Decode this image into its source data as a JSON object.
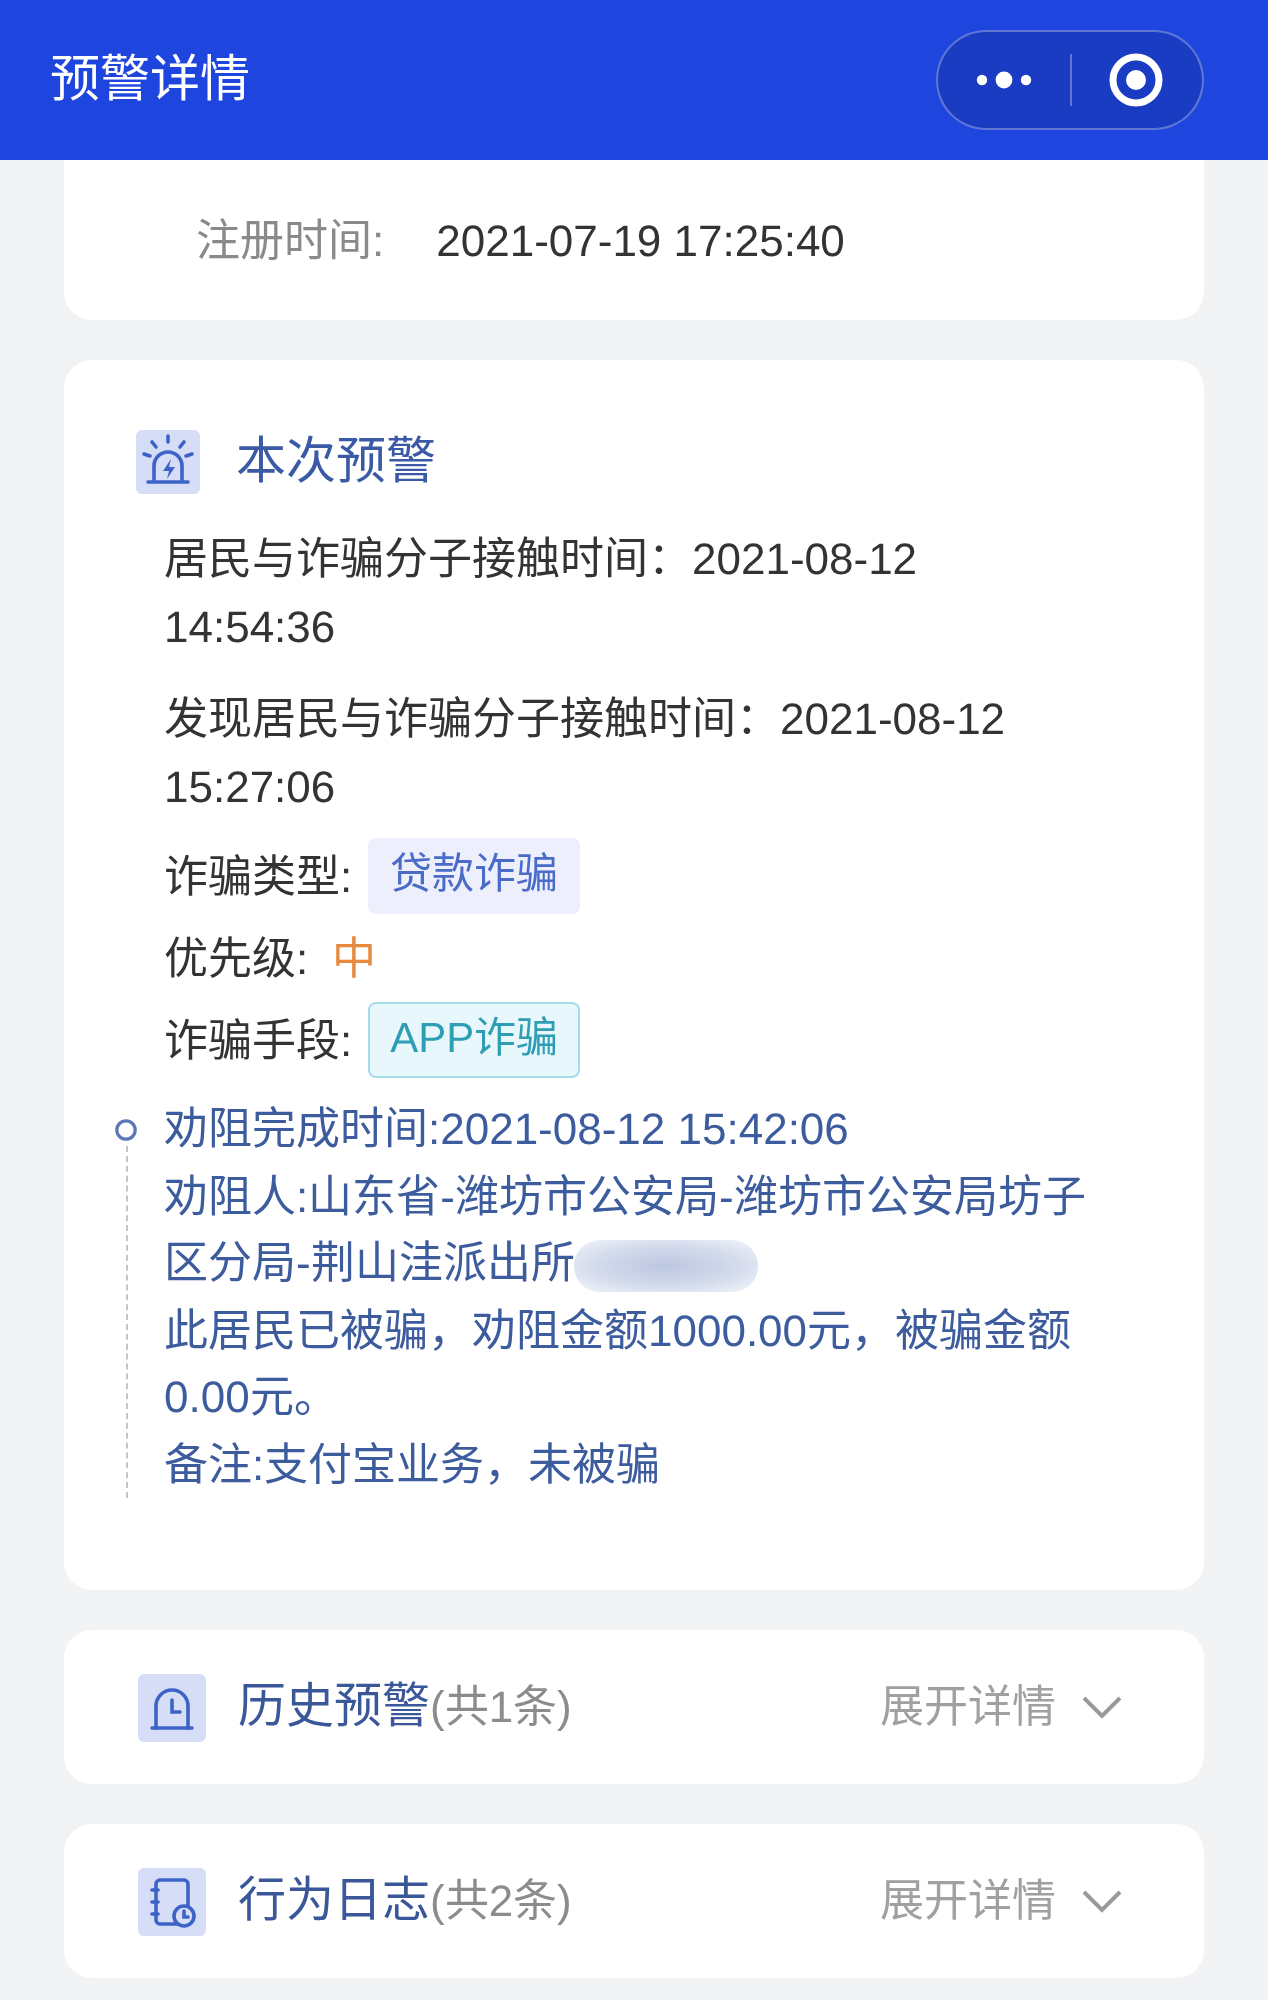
{
  "header": {
    "title": "预警详情"
  },
  "registration": {
    "label": "注册时间:",
    "value": "2021-07-19 17:25:40"
  },
  "alert": {
    "title": "本次预警",
    "lines": [
      "居民与诈骗分子接触时间：2021-08-12 14:54:36",
      "发现居民与诈骗分子接触时间：2021-08-12 15:27:06"
    ],
    "fields": [
      {
        "kind": "chip",
        "label": "诈骗类型:",
        "value": "贷款诈骗"
      },
      {
        "kind": "accent",
        "label": "优先级:",
        "value": "中"
      },
      {
        "kind": "outline",
        "label": "诈骗手段:",
        "value": "APP诈骗"
      }
    ],
    "disposal": [
      {
        "text": "劝阻完成时间:2021-08-12 15:42:06",
        "redacted": false
      },
      {
        "text": "劝阻人:山东省-潍坊市公安局-潍坊市公安局坊子区分局-荆山洼派出所",
        "redacted": true
      },
      {
        "text": "此居民已被骗，劝阻金额1000.00元，被骗金额0.00元。",
        "redacted": false
      },
      {
        "text": "备注:支付宝业务，未被骗",
        "redacted": false
      }
    ]
  },
  "sections": [
    {
      "kind": "history",
      "title": "历史预警",
      "count": "(共1条)",
      "action": "展开详情",
      "expanded": false
    },
    {
      "kind": "log",
      "title": "行为日志",
      "count": "(共2条)",
      "action": "展开详情",
      "expanded": false
    }
  ]
}
